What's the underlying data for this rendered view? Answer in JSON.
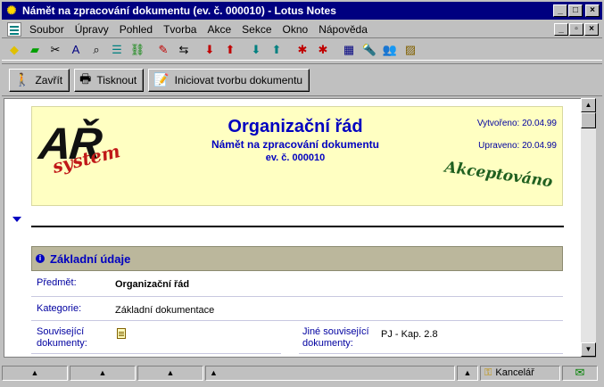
{
  "window": {
    "title": "Námět na zpracování dokumentu (ev. č. 000010) - Lotus Notes",
    "minimize": "_",
    "maximize": "□",
    "close": "×",
    "restore": "▫"
  },
  "menu": {
    "items": [
      "Soubor",
      "Úpravy",
      "Pohled",
      "Tvorba",
      "Akce",
      "Sekce",
      "Okno",
      "Nápověda"
    ]
  },
  "toolbar": {
    "icons": [
      "diamond-icon",
      "open-database-icon",
      "cut-icon",
      "text-properties-icon",
      "find-icon",
      "outline-icon",
      "link-icon",
      "edit-pen-icon",
      "navigate-icon",
      "previous-icon",
      "next-icon",
      "previous-main-icon",
      "next-main-icon",
      "previous-unread-icon",
      "next-unread-icon",
      "database-properties-icon",
      "search-icon",
      "people-icon",
      "properties-icon"
    ]
  },
  "actions": {
    "close_label": "Zavřít",
    "print_label": "Tisknout",
    "initiate_label": "Iniciovat tvorbu dokumentu"
  },
  "document": {
    "logo_main": "AŘ",
    "logo_sub": "system",
    "title": "Organizační řád",
    "subtitle": "Námět na zpracování dokumentu",
    "number": "ev. č. 000010",
    "created": "Vytvořeno: 20.04.99",
    "modified": "Upraveno: 20.04.99",
    "stamp": "Akceptováno"
  },
  "section": {
    "title": "Základní údaje",
    "fields": {
      "subject_label": "Předmět:",
      "subject_value": "Organizační řád",
      "category_label": "Kategorie:",
      "category_value": "Základní dokumentace",
      "related_label_1": "Související",
      "related_label_2": "dokumenty:",
      "other_related_label_1": "Jiné související",
      "other_related_label_2": "dokumenty:",
      "other_related_value": "PJ - Kap. 2.8"
    }
  },
  "status": {
    "location": "Kancelář"
  },
  "colors": {
    "accent_blue": "#0000c0",
    "header_bg": "#ffffc2",
    "section_bg": "#bbb79c",
    "stamp_green": "#206020",
    "logo_red": "#c01818"
  }
}
